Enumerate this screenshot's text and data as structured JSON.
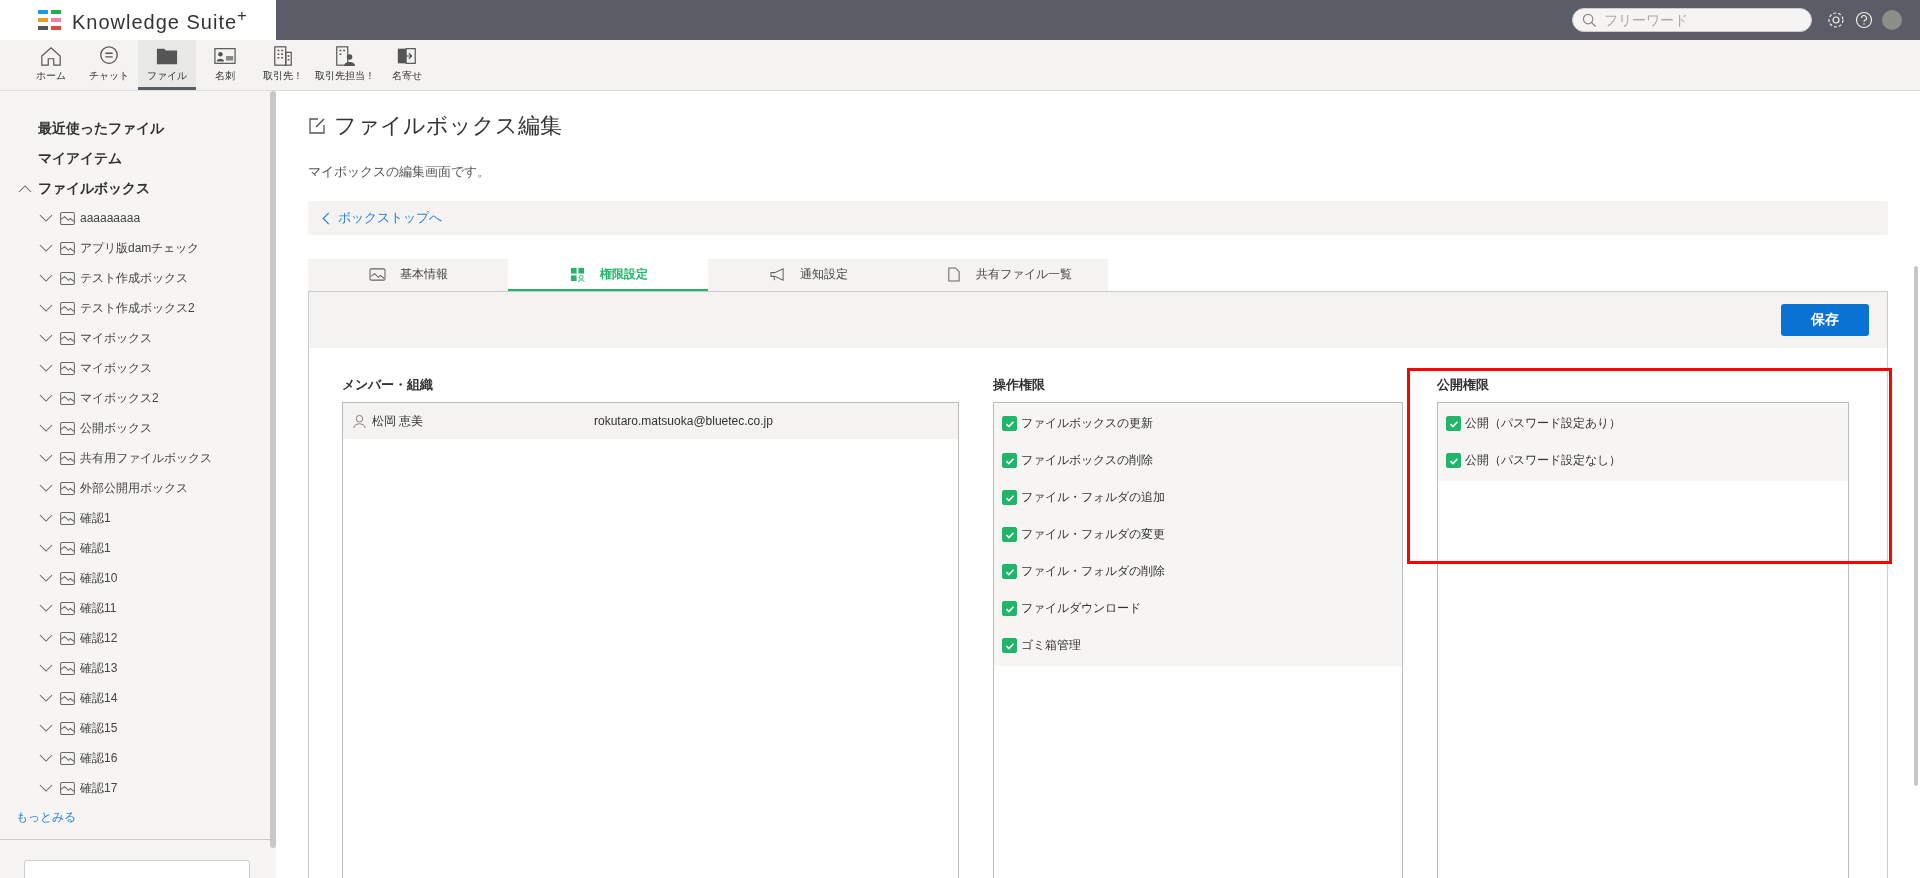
{
  "header": {
    "logo": "Knowledge Suite$^{+}$",
    "search": {
      "placeholder": "フリーワード"
    }
  },
  "nav": [
    {
      "label": "ホーム",
      "selected": false
    },
    {
      "label": "チャット",
      "selected": false
    },
    {
      "label": "ファイル",
      "selected": true
    },
    {
      "label": "名刺",
      "selected": false
    },
    {
      "label": "取引先！",
      "selected": false
    },
    {
      "label": "取引先担当！",
      "selected": false
    },
    {
      "label": "名寄せ",
      "selected": false
    }
  ],
  "sidebar": {
    "top_items": [
      {
        "label": "最近使ったファイル"
      },
      {
        "label": "マイアイテム"
      }
    ],
    "filebox": {
      "label": "ファイルボックス",
      "expanded": true,
      "children": [
        {
          "label": "aaaaaaaaa",
          "expanded": false
        },
        {
          "label": "アプリ版damチェック",
          "expanded": false
        },
        {
          "label": "テスト作成ボックス",
          "expanded": false
        },
        {
          "label": "テスト作成ボックス2",
          "expanded": false
        },
        {
          "label": "マイボックス",
          "expanded": false
        },
        {
          "label": "マイボックス",
          "expanded": false
        },
        {
          "label": "マイボックス2",
          "expanded": false
        },
        {
          "label": "公開ボックス",
          "expanded": false
        },
        {
          "label": "共有用ファイルボックス",
          "expanded": false
        },
        {
          "label": "外部公開用ボックス",
          "expanded": false
        },
        {
          "label": "確認1",
          "expanded": false
        },
        {
          "label": "確認1",
          "expanded": false
        },
        {
          "label": "確認10",
          "expanded": false
        },
        {
          "label": "確認11",
          "expanded": false
        },
        {
          "label": "確認12",
          "expanded": false
        },
        {
          "label": "確認13",
          "expanded": false
        },
        {
          "label": "確認14",
          "expanded": false
        },
        {
          "label": "確認15",
          "expanded": false
        },
        {
          "label": "確認16",
          "expanded": false
        },
        {
          "label": "確認17",
          "expanded": false
        }
      ]
    },
    "more_link": "もっとみる"
  },
  "page": {
    "title": "ファイルボックス編集",
    "description": "マイボックスの編集画面です。",
    "back_link": "ボックストップへ",
    "tabs": [
      {
        "label": "基本情報",
        "selected": false
      },
      {
        "label": "権限設定",
        "selected": true
      },
      {
        "label": "通知設定",
        "selected": false
      },
      {
        "label": "共有ファイル一覧",
        "selected": false
      }
    ],
    "save_button": "保存",
    "members": {
      "heading": "メンバー・組織",
      "rows": [
        {
          "name": "松岡 恵美",
          "email": "rokutaro.matsuoka@bluetec.co.jp"
        }
      ]
    },
    "operations": {
      "heading": "操作権限",
      "items": [
        {
          "label": "ファイルボックスの更新",
          "checked": true
        },
        {
          "label": "ファイルボックスの削除",
          "checked": true
        },
        {
          "label": "ファイル・フォルダの追加",
          "checked": true
        },
        {
          "label": "ファイル・フォルダの変更",
          "checked": true
        },
        {
          "label": "ファイル・フォルダの削除",
          "checked": true
        },
        {
          "label": "ファイルダウンロード",
          "checked": true
        },
        {
          "label": "ゴミ箱管理",
          "checked": true
        }
      ]
    },
    "publication": {
      "heading": "公開権限",
      "highlighted": true,
      "items": [
        {
          "label": "公開（パスワード設定あり）",
          "checked": true
        },
        {
          "label": "公開（パスワード設定なし）",
          "checked": true
        }
      ]
    }
  }
}
